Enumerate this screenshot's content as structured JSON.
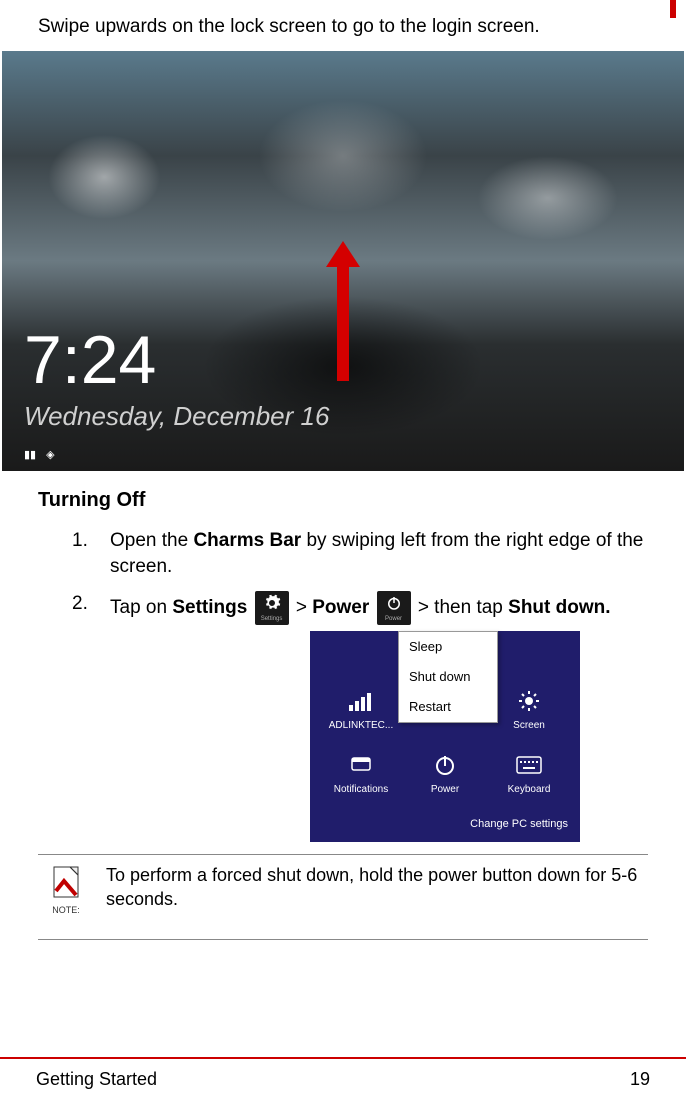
{
  "intro": "Swipe upwards on the lock screen to go to the login screen.",
  "lockscreen": {
    "time": "7:24",
    "date": "Wednesday, December 16"
  },
  "section_heading": "Turning Off",
  "steps": [
    {
      "num": "1.",
      "parts": {
        "a": "Open the ",
        "b_bold": "Charms Bar",
        "c": " by swiping left from the right edge of the screen."
      }
    },
    {
      "num": "2.",
      "parts": {
        "a": "Tap on ",
        "b_bold": "Settings",
        "c": "  > ",
        "d_bold": "Power",
        "e": "  > then tap ",
        "f_bold": "Shut down."
      }
    }
  ],
  "inline_icons": {
    "settings_label": "Settings",
    "power_label": "Power"
  },
  "power_menu": [
    "Sleep",
    "Shut down",
    "Restart"
  ],
  "settings_grid": {
    "row1": [
      {
        "label": "ADLINKTEC..."
      },
      {
        "label": ""
      },
      {
        "label": "Screen"
      }
    ],
    "row2": [
      {
        "label": "Notifications"
      },
      {
        "label": "Power"
      },
      {
        "label": "Keyboard"
      }
    ],
    "change_link": "Change PC settings"
  },
  "note": {
    "word": "NOTE:",
    "text": "To perform a forced shut down, hold the power button down for 5-6 seconds."
  },
  "footer": {
    "section": "Getting Started",
    "page": "19"
  }
}
